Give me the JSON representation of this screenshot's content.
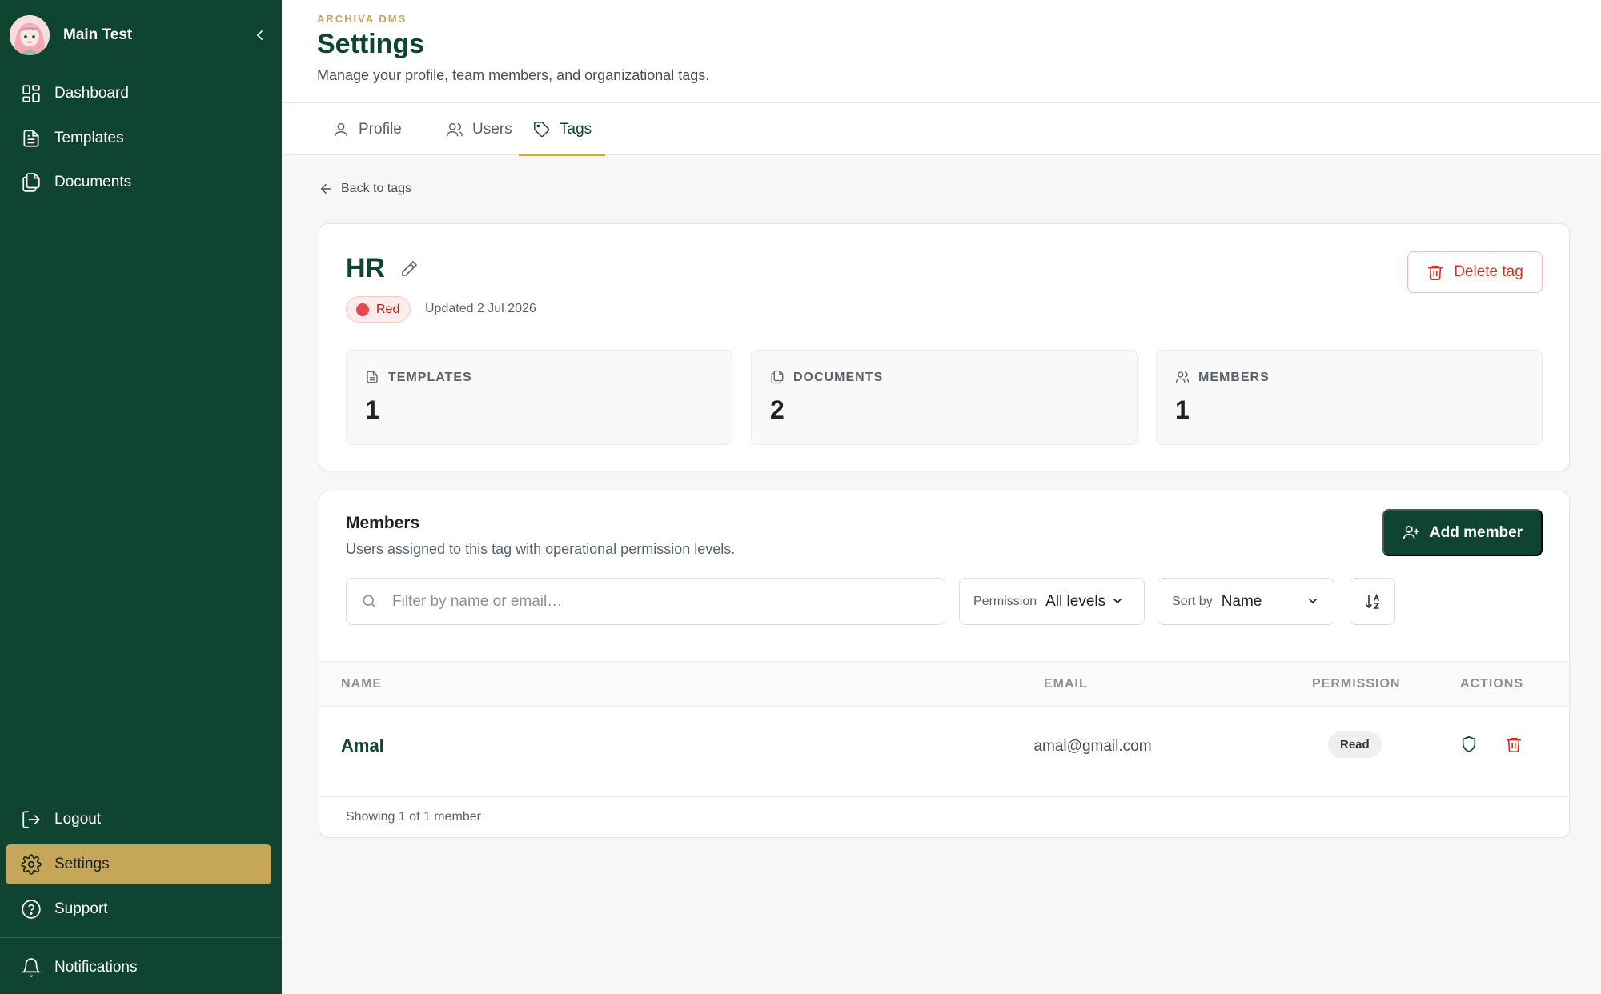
{
  "sidebar": {
    "user_name": "Main Test",
    "nav": [
      {
        "label": "Dashboard",
        "icon": "dashboard-icon"
      },
      {
        "label": "Templates",
        "icon": "file-text-icon"
      },
      {
        "label": "Documents",
        "icon": "documents-icon"
      }
    ],
    "bottom": [
      {
        "label": "Logout",
        "icon": "logout-icon"
      },
      {
        "label": "Settings",
        "icon": "gear-icon",
        "active": true
      },
      {
        "label": "Support",
        "icon": "help-circle-icon"
      },
      {
        "label": "Notifications",
        "icon": "bell-icon"
      }
    ]
  },
  "header": {
    "eyebrow": "ARCHIVA DMS",
    "title": "Settings",
    "subtitle": "Manage your profile, team members, and organizational tags."
  },
  "tabs": [
    {
      "label": "Profile",
      "icon": "user-icon"
    },
    {
      "label": "Users",
      "icon": "users-icon"
    },
    {
      "label": "Tags",
      "icon": "tag-icon",
      "active": true
    }
  ],
  "back_label": "Back to tags",
  "tag": {
    "name": "HR",
    "color_label": "Red",
    "updated": "Updated 2 Jul 2026",
    "delete_label": "Delete tag",
    "stats": [
      {
        "label": "TEMPLATES",
        "value": "1",
        "icon": "file-text-icon"
      },
      {
        "label": "DOCUMENTS",
        "value": "2",
        "icon": "documents-icon"
      },
      {
        "label": "MEMBERS",
        "value": "1",
        "icon": "users-icon"
      }
    ]
  },
  "members": {
    "title": "Members",
    "subtitle": "Users assigned to this tag with operational permission levels.",
    "add_label": "Add member",
    "search_placeholder": "Filter by name or email…",
    "permission_filter": {
      "label": "Permission",
      "value": "All levels"
    },
    "sort": {
      "label": "Sort by",
      "value": "Name"
    },
    "columns": {
      "name": "NAME",
      "email": "EMAIL",
      "permission": "PERMISSION",
      "actions": "ACTIONS"
    },
    "rows": [
      {
        "name": "Amal",
        "email": "amal@gmail.com",
        "permission": "Read"
      }
    ],
    "footer": "Showing 1 of 1 member"
  },
  "colors": {
    "sidebar_bg": "#0f4430",
    "accent_gold": "#c6a75a",
    "danger": "#d92d20",
    "tag_red": "#e5484d"
  }
}
